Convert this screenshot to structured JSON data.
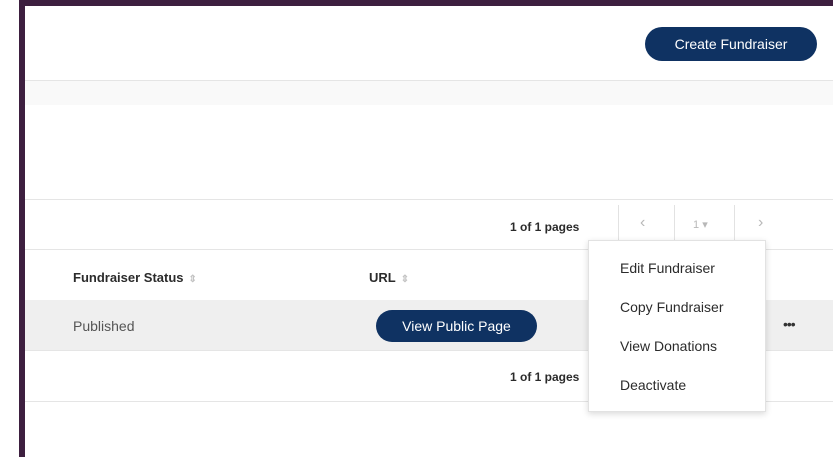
{
  "header": {
    "create_label": "Create Fundraiser"
  },
  "pagination": {
    "top_text": "1 of 1 pages",
    "bottom_text": "1 of 1 pages",
    "prev_icon": "‹",
    "next_icon": "›",
    "page_value": "1",
    "page_dropdown_icon": "▾"
  },
  "table": {
    "columns": [
      "Fundraiser Status",
      "URL"
    ],
    "sort_icon": "⇕",
    "rows": [
      {
        "status": "Published",
        "url_button": "View Public Page",
        "actions_icon": "•••"
      }
    ]
  },
  "actions_menu": {
    "items": [
      "Edit Fundraiser",
      "Copy Fundraiser",
      "View Donations",
      "Deactivate"
    ]
  },
  "colors": {
    "frame": "#3d1f3f",
    "primary_button": "#0f3262",
    "row_background": "#efefef"
  }
}
